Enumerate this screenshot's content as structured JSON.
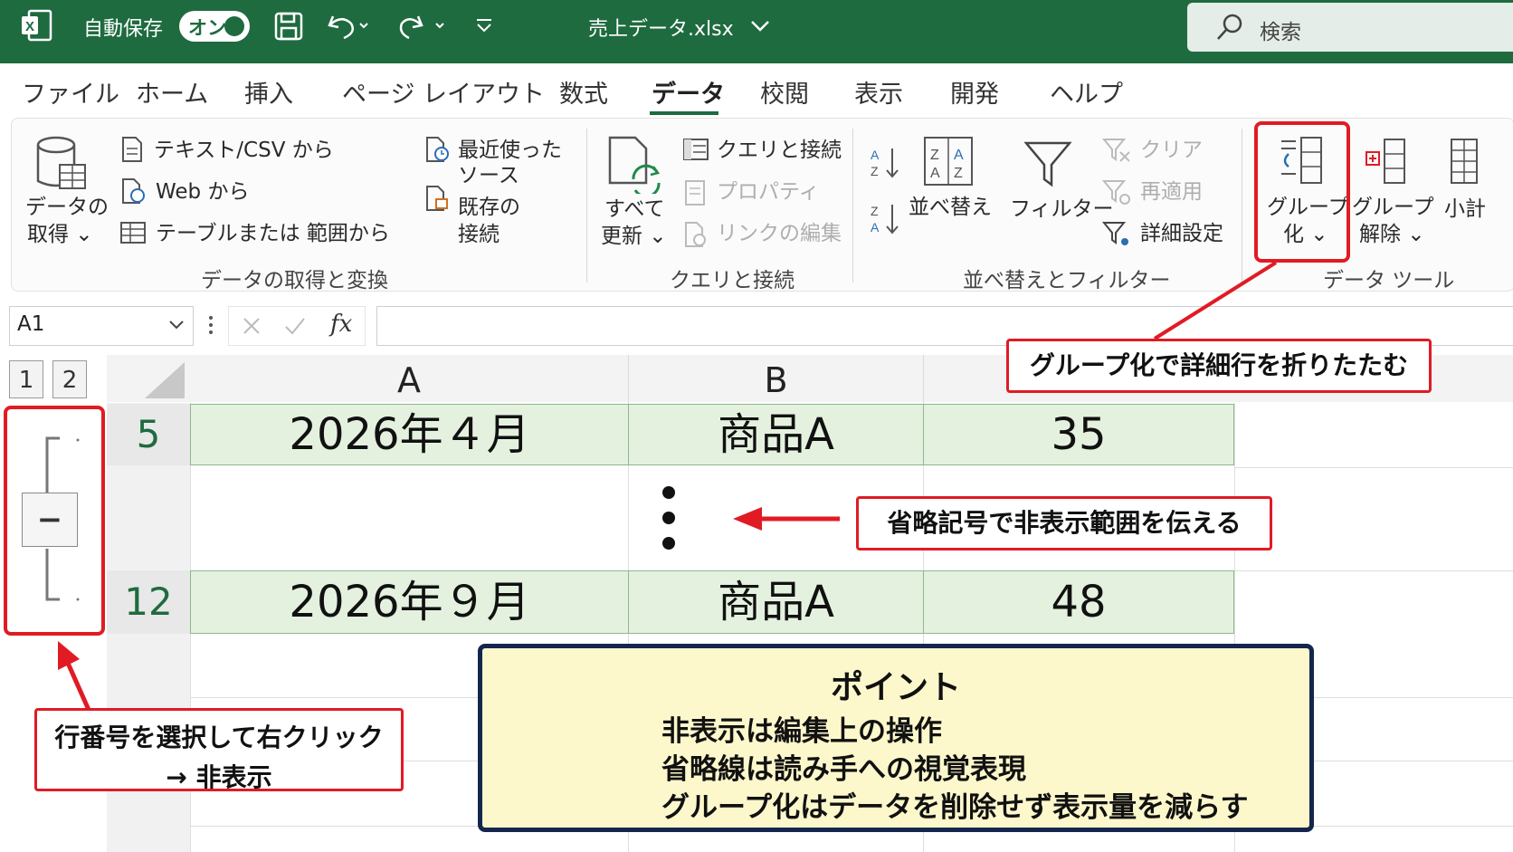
{
  "titlebar": {
    "autosave_label": "自動保存",
    "autosave_state": "オン",
    "filename": "売上データ.xlsx",
    "search_placeholder": "検索",
    "bg_color": "#1e6b3f"
  },
  "menu": {
    "tabs": [
      "ファイル",
      "ホーム",
      "挿入",
      "ページ レイアウト",
      "数式",
      "データ",
      "校閲",
      "表示",
      "開発",
      "ヘルプ"
    ],
    "active": "データ"
  },
  "ribbon": {
    "get_data": {
      "line1": "データの",
      "line2": "取得 ⌄"
    },
    "text_csv": "テキスト/CSV から",
    "web": "Web から",
    "table_range": "テーブルまたは 範囲から",
    "recent_1": "最近使った",
    "recent_2": "ソース",
    "existing_1": "既存の",
    "existing_2": "接続",
    "group_get_transform": "データの取得と変換",
    "refresh_all_1": "すべて",
    "refresh_all_2": "更新 ⌄",
    "queries_connections": "クエリと接続",
    "properties": "プロパティ",
    "edit_links": "リンクの編集",
    "group_queries": "クエリと接続",
    "sort": "並べ替え",
    "filter": "フィルター",
    "clear": "クリア",
    "reapply": "再適用",
    "advanced": "詳細設定",
    "group_sort_filter": "並べ替えとフィルター",
    "group_btn_1": "グループ",
    "group_btn_2": "化 ⌄",
    "ungroup_1": "グループ",
    "ungroup_2": "解除 ⌄",
    "subtotal": "小計",
    "group_data_tools": "データ ツール"
  },
  "formula_bar": {
    "name_box": "A1",
    "fx": "fx",
    "formula": ""
  },
  "outline": {
    "levels": [
      "1",
      "2"
    ],
    "collapse_symbol": "−"
  },
  "sheet": {
    "columns": [
      "A",
      "B"
    ],
    "rows": [
      {
        "header": "5",
        "date": "2026年４月",
        "product": "商品A",
        "qty": "35"
      },
      {
        "header": "12",
        "date": "2026年９月",
        "product": "商品A",
        "qty": "48"
      }
    ]
  },
  "annotations": {
    "group_callout": "グループ化で詳細行を折りたたむ",
    "ellipsis_callout": "省略記号で非表示範囲を伝える",
    "hide_callout_1": "行番号を選択して右クリック",
    "hide_callout_2": "→ 非表示",
    "accent_color": "#e01b24"
  },
  "point_box": {
    "title": "ポイント",
    "lines": [
      "非表示は編集上の操作",
      "省略線は読み手への視覚表現",
      "グループ化はデータを削除せず表示量を減らす"
    ]
  }
}
